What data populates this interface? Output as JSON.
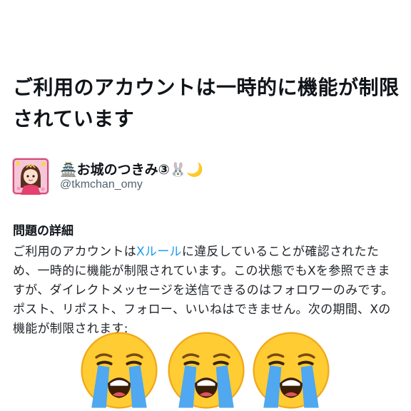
{
  "page": {
    "title": "ご利用のアカウントは一時的に機能が制限されています"
  },
  "account": {
    "display_name": "🏯お城のつきみ③🐰🌙",
    "handle": "@tkmchan_omy",
    "avatar_icon": "profile-avatar-image"
  },
  "details": {
    "heading": "問題の詳細",
    "text_before_link": "ご利用のアカウントは",
    "link_text": "Xルール",
    "text_after_link": "に違反していることが確認されたため、一時的に機能が制限されています。この状態でもXを参照できますが、ダイレクトメッセージを送信できるのはフォロワーのみです。ポスト、リポスト、フォロー、いいねはできません。次の期間、Xの機能が制限されます:"
  },
  "reactions": {
    "icons": [
      "loudly-crying-face-icon",
      "loudly-crying-face-icon",
      "loudly-crying-face-icon"
    ]
  }
}
